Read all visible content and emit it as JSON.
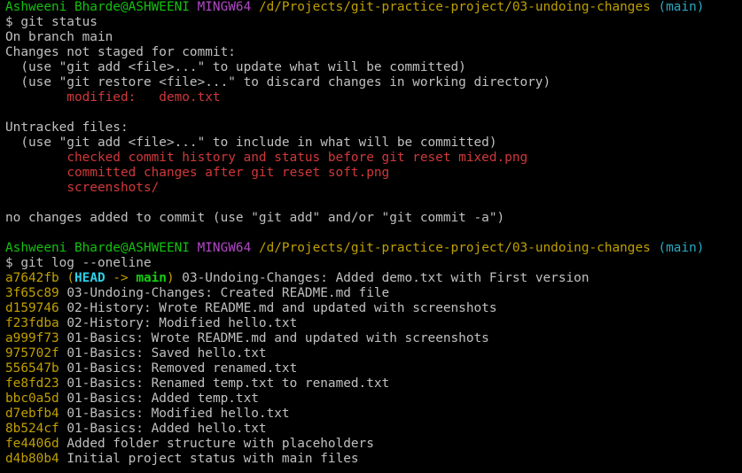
{
  "prompts": [
    {
      "user": "Ashweeni Bharde@ASHWEENI",
      "env": "MINGW64",
      "path": "/d/Projects/git-practice-project/03-undoing-changes",
      "branch": "(main)",
      "command": "$ git status"
    },
    {
      "user": "Ashweeni Bharde@ASHWEENI",
      "env": "MINGW64",
      "path": "/d/Projects/git-practice-project/03-undoing-changes",
      "branch": "(main)",
      "command": "$ git log --oneline"
    }
  ],
  "status": {
    "on_branch": "On branch main",
    "not_staged_header": "Changes not staged for commit:",
    "hint_add": "  (use \"git add <file>...\" to update what will be committed)",
    "hint_restore": "  (use \"git restore <file>...\" to discard changes in working directory)",
    "modified_label": "        modified:   ",
    "modified_file": "demo.txt",
    "untracked_header": "Untracked files:",
    "hint_include": "  (use \"git add <file>...\" to include in what will be committed)",
    "untracked_files": [
      "checked commit history and status before git reset mixed.png",
      "committed changes after git reset soft.png",
      "screenshots/"
    ],
    "summary": "no changes added to commit (use \"git add\" and/or \"git commit -a\")"
  },
  "log": {
    "head_commit": {
      "hash": "a7642fb",
      "head_label": "HEAD",
      "arrow": " -> ",
      "branch_label": "main",
      "message": " 03-Undoing-Changes: Added demo.txt with First version"
    },
    "commits": [
      {
        "hash": "3f65c89",
        "message": "03-Undoing-Changes: Created README.md file"
      },
      {
        "hash": "d159746",
        "message": "02-History: Wrote README.md and updated with screenshots"
      },
      {
        "hash": "f23fdba",
        "message": "02-History: Modified hello.txt"
      },
      {
        "hash": "a999f73",
        "message": "01-Basics: Wrote README.md and updated with screenshots"
      },
      {
        "hash": "975702f",
        "message": "01-Basics: Saved hello.txt"
      },
      {
        "hash": "556547b",
        "message": "01-Basics: Removed renamed.txt"
      },
      {
        "hash": "fe8fd23",
        "message": "01-Basics: Renamed temp.txt to renamed.txt"
      },
      {
        "hash": "bbc0a5d",
        "message": "01-Basics: Added temp.txt"
      },
      {
        "hash": "d7ebfb4",
        "message": "01-Basics: Modified hello.txt"
      },
      {
        "hash": "8b524cf",
        "message": "01-Basics: Added hello.txt"
      },
      {
        "hash": "fe4406d",
        "message": "Added folder structure with placeholders"
      },
      {
        "hash": "d4b80b4",
        "message": "Initial project status with main files"
      }
    ]
  },
  "colors": {
    "background": "#000000",
    "text": "#c0c0c0",
    "user": "#13c20f",
    "env": "#b148c6",
    "path": "#c0a000",
    "branch": "#2aa9c3",
    "modified": "#d0383a",
    "hash": "#c0a000"
  }
}
